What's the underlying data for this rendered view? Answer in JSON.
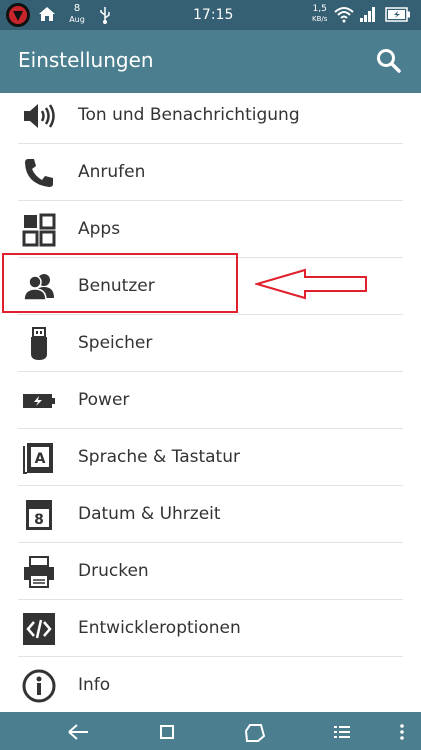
{
  "status_bar": {
    "date_day": "8",
    "date_month": "Aug",
    "time": "17:15",
    "net_speed_value": "1,5",
    "net_speed_unit": "KB/s",
    "icons": [
      "app-notification-icon",
      "home-icon",
      "calendar-icon",
      "usb-icon",
      "wifi-icon",
      "signal-icon",
      "battery-icon"
    ]
  },
  "app_bar": {
    "title": "Einstellungen",
    "search_icon": "search-icon"
  },
  "settings": {
    "items": [
      {
        "label": "Ton und Benachrichtigung",
        "icon": "speaker-icon"
      },
      {
        "label": "Anrufen",
        "icon": "phone-icon"
      },
      {
        "label": "Apps",
        "icon": "apps-grid-icon"
      },
      {
        "label": "Benutzer",
        "icon": "users-icon"
      },
      {
        "label": "Speicher",
        "icon": "usb-storage-icon"
      },
      {
        "label": "Power",
        "icon": "battery-icon"
      },
      {
        "label": "Sprache & Tastatur",
        "icon": "language-icon"
      },
      {
        "label": "Datum & Uhrzeit",
        "icon": "calendar-icon"
      },
      {
        "label": "Drucken",
        "icon": "printer-icon"
      },
      {
        "label": "Entwickleroptionen",
        "icon": "code-icon"
      },
      {
        "label": "Info",
        "icon": "info-icon"
      }
    ],
    "language_icon_letter": "A",
    "calendar_icon_number": "8"
  },
  "annotation": {
    "highlight_color": "#e0202c"
  },
  "colors": {
    "status_bar": "#355f72",
    "app_bar": "#4b7e8f",
    "nav_bar": "#4b7e8f",
    "icon": "#333333"
  }
}
